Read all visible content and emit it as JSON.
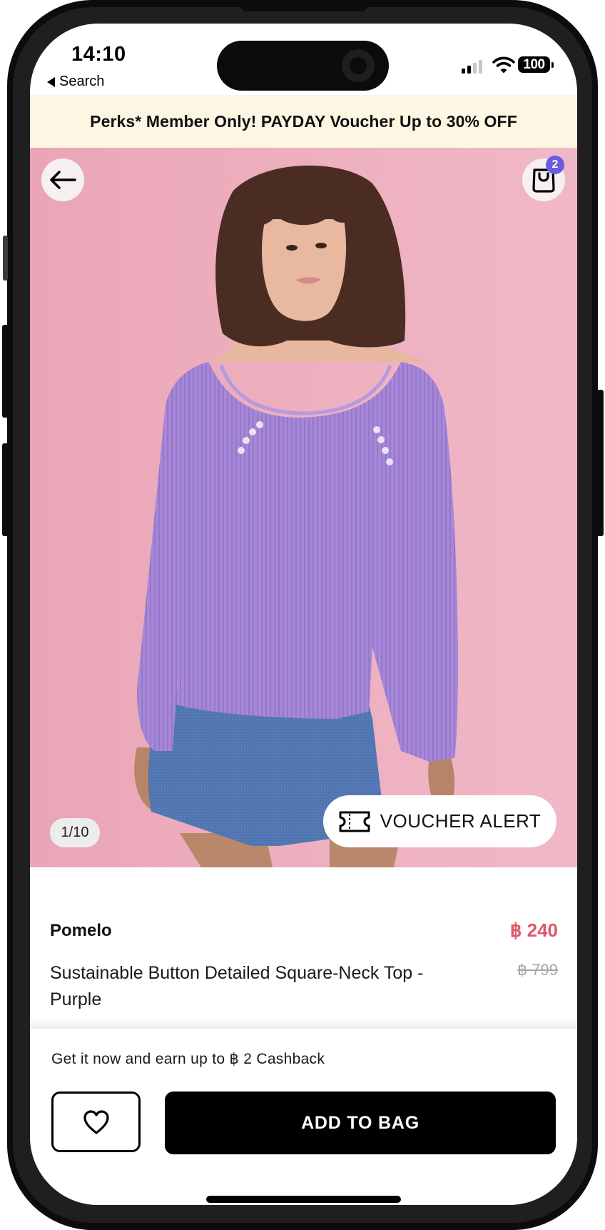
{
  "status_bar": {
    "time": "14:10",
    "back_app_label": "Search",
    "battery": "100",
    "signal_bars_active": 2,
    "signal_bars_total": 4
  },
  "promo_banner": {
    "text": "Perks* Member Only! PAYDAY Voucher Up to 30% OFF"
  },
  "header": {
    "back_icon": "arrow-left-icon",
    "cart_icon": "shopping-bag-icon",
    "cart_count": "2"
  },
  "gallery": {
    "counter": "1/10",
    "current": 1,
    "total": 10,
    "voucher_alert_label": "VOUCHER ALERT",
    "voucher_icon": "ticket-icon"
  },
  "product": {
    "brand": "Pomelo",
    "name": "Sustainable Button Detailed Square-Neck Top - Purple",
    "price": "฿ 240",
    "original_price": "฿ 799"
  },
  "actions": {
    "cashback_text": "Get it now and earn up to ฿ 2 Cashback",
    "wishlist_icon": "heart-icon",
    "add_to_bag_label": "ADD TO BAG"
  },
  "colors": {
    "banner_bg": "#fcf6e3",
    "hero_bg": "#efb3c3",
    "price_sale": "#e0566a",
    "price_original": "#a6a6a6",
    "badge": "#6a5ce0",
    "primary_button": "#000000"
  }
}
